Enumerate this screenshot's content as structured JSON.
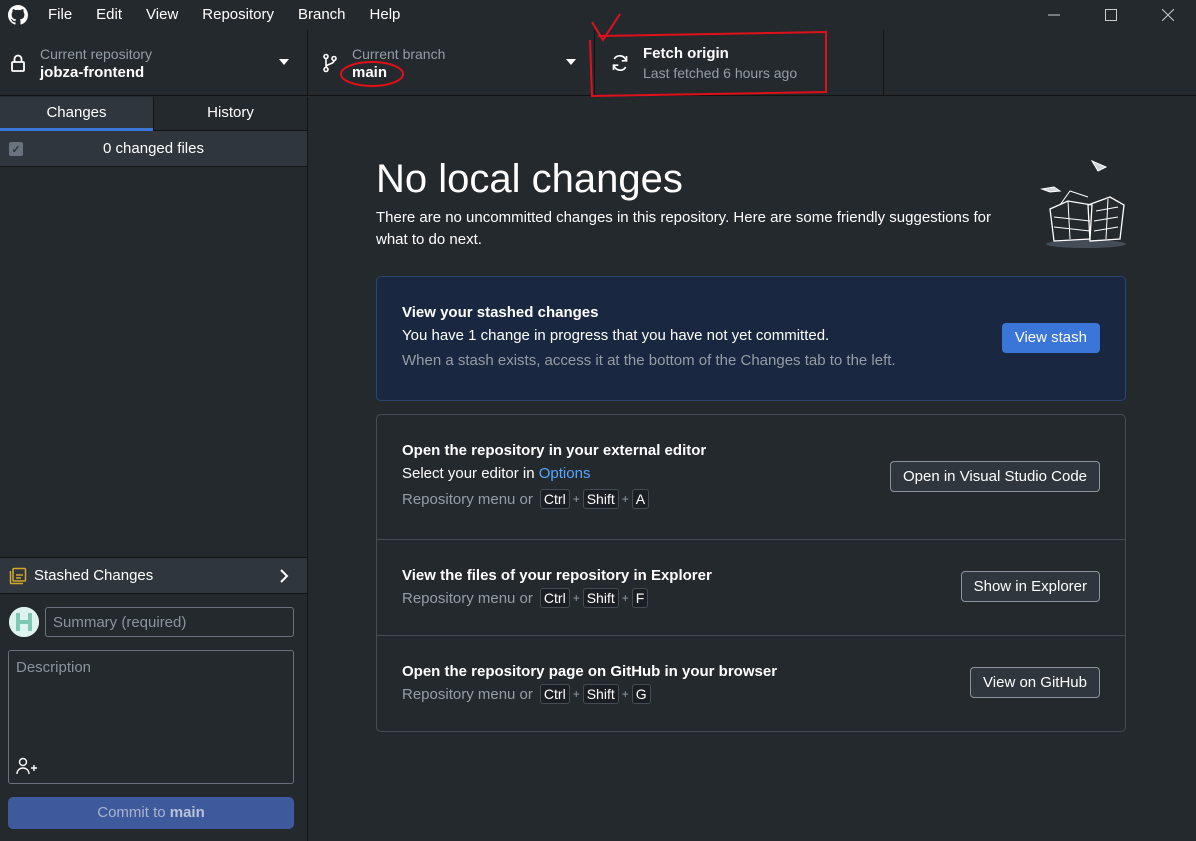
{
  "menu": [
    "File",
    "Edit",
    "View",
    "Repository",
    "Branch",
    "Help"
  ],
  "toolbar": {
    "repo_label": "Current repository",
    "repo_name": "jobza-frontend",
    "branch_label": "Current branch",
    "branch_name": "main",
    "fetch_title": "Fetch origin",
    "fetch_sub": "Last fetched 6 hours ago"
  },
  "sidebar": {
    "tab_changes": "Changes",
    "tab_history": "History",
    "changed_files": "0 changed files",
    "stashed_label": "Stashed Changes",
    "summary_placeholder": "Summary (required)",
    "description_placeholder": "Description",
    "commit_prefix": "Commit to",
    "commit_branch": "main"
  },
  "main": {
    "heading": "No local changes",
    "subtext": "There are no uncommitted changes in this repository. Here are some friendly suggestions for what to do next.",
    "stash_card": {
      "title": "View your stashed changes",
      "line": "You have 1 change in progress that you have not yet committed.",
      "hint": "When a stash exists, access it at the bottom of the Changes tab to the left.",
      "button": "View stash"
    },
    "editor": {
      "title": "Open the repository in your external editor",
      "line_prefix": "Select your editor in",
      "line_link": "Options",
      "hint_prefix": "Repository menu or",
      "keys": [
        "Ctrl",
        "Shift",
        "A"
      ],
      "button": "Open in Visual Studio Code"
    },
    "explorer": {
      "title": "View the files of your repository in Explorer",
      "hint_prefix": "Repository menu or",
      "keys": [
        "Ctrl",
        "Shift",
        "F"
      ],
      "button": "Show in Explorer"
    },
    "github": {
      "title": "Open the repository page on GitHub in your browser",
      "hint_prefix": "Repository menu or",
      "keys": [
        "Ctrl",
        "Shift",
        "G"
      ],
      "button": "View on GitHub"
    }
  },
  "colors": {
    "accent": "#3a75d8",
    "annotation": "#e0101a"
  }
}
